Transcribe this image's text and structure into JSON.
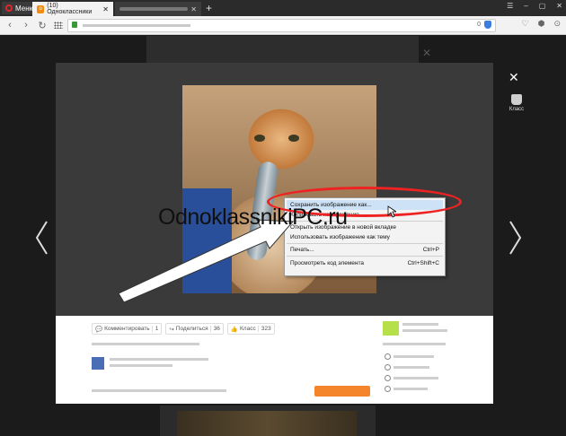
{
  "browser": {
    "menu_label": "Меню",
    "active_tab_title": "(10) Одноклассники",
    "active_tab_icon": "ok-favicon",
    "new_tab": "+",
    "window_controls": [
      "–",
      "▢",
      "✕"
    ],
    "url_badge": "0"
  },
  "viewer": {
    "close": "✕",
    "klass_label": "Класс",
    "prev": "prev-arrow",
    "next": "next-arrow"
  },
  "context_menu": {
    "items": [
      {
        "label": "Сохранить изображение как...",
        "shortcut": ""
      },
      {
        "label": "Копировать изображение",
        "shortcut": ""
      },
      {
        "label": "Открыть изображение в новой вкладке",
        "shortcut": ""
      },
      {
        "label": "Использовать изображение как тему",
        "shortcut": ""
      },
      {
        "label": "Печать...",
        "shortcut": "Ctrl+P"
      },
      {
        "label": "Просмотреть код элемента",
        "shortcut": "Ctrl+Shift+C"
      }
    ]
  },
  "actions": {
    "comment_label": "Комментировать",
    "comment_count": "1",
    "share_label": "Поделиться",
    "share_count": "36",
    "klass_label": "Класс",
    "klass_count": "323"
  },
  "watermark": "OdnoklassnikiPC.ru",
  "colors": {
    "highlight_oval": "#e22222",
    "ok_orange": "#f48a0a",
    "modal_bg": "#3a3a3a"
  }
}
